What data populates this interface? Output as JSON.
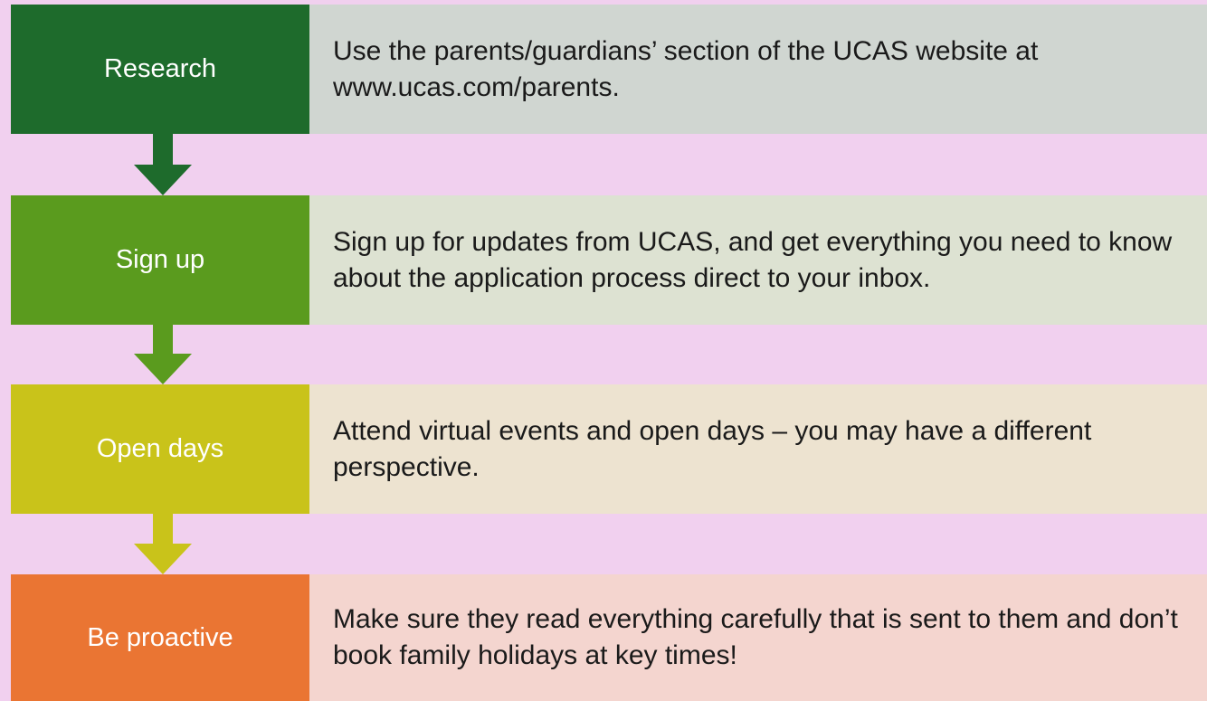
{
  "steps": [
    {
      "label": "Research",
      "description": "Use the parents/guardians’ section of the UCAS website at www.ucas.com/parents.",
      "color": "#1e6b2c"
    },
    {
      "label": "Sign up",
      "description": "Sign up for updates from UCAS, and get everything you need to know about the application process direct to your inbox.",
      "color": "#5a9b1e"
    },
    {
      "label": "Open days",
      "description": "Attend virtual events and open days – you may have a different perspective.",
      "color": "#c9c31a"
    },
    {
      "label": "Be proactive",
      "description": "Make sure they read everything carefully that is sent to them and don’t book family holidays at key times!",
      "color": "#ea7533"
    }
  ]
}
